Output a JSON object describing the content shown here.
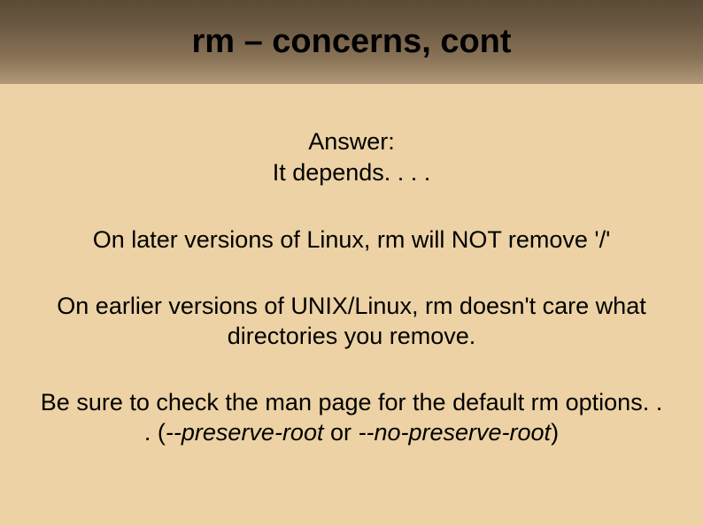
{
  "title": "rm – concerns, cont",
  "answer": {
    "label": "Answer:",
    "text": "It depends. . . ."
  },
  "paragraphs": {
    "p1": "On later versions of Linux, rm will NOT remove '/'",
    "p2": "On earlier versions of UNIX/Linux, rm doesn't care what directories you remove.",
    "p3_pre": "Be sure to check the man page for the default rm options. . . (",
    "p3_opt1": "--preserve-root",
    "p3_mid": " or ",
    "p3_opt2": "--no-preserve-root",
    "p3_post": ")"
  }
}
